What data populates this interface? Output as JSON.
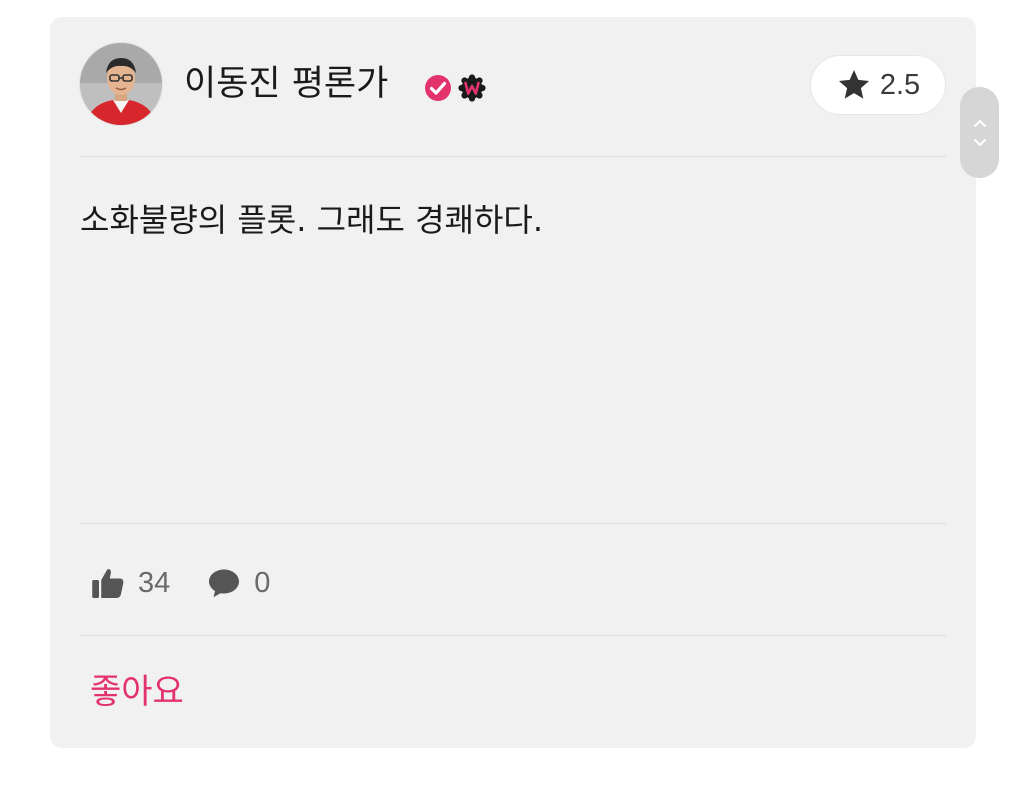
{
  "review": {
    "author": {
      "name": "이동진 평론가",
      "verified_icon": "verified-check-icon",
      "watcha_badge_icon": "watcha-w-badge-icon",
      "avatar": "avatar-photo"
    },
    "rating": {
      "icon": "star-icon",
      "value": "2.5"
    },
    "comment": "소화불량의 플롯. 그래도 경쾌하다.",
    "stats": {
      "likes": {
        "icon": "thumbs-up-icon",
        "count": "34"
      },
      "comments": {
        "icon": "speech-bubble-icon",
        "count": "0"
      }
    },
    "like_button_label": "좋아요"
  },
  "colors": {
    "card_background": "#f1f1f1",
    "accent": "#e3336d",
    "badge_dark": "#1a1a1a",
    "text": "#1a1a1a",
    "muted": "#6a6a6a"
  }
}
